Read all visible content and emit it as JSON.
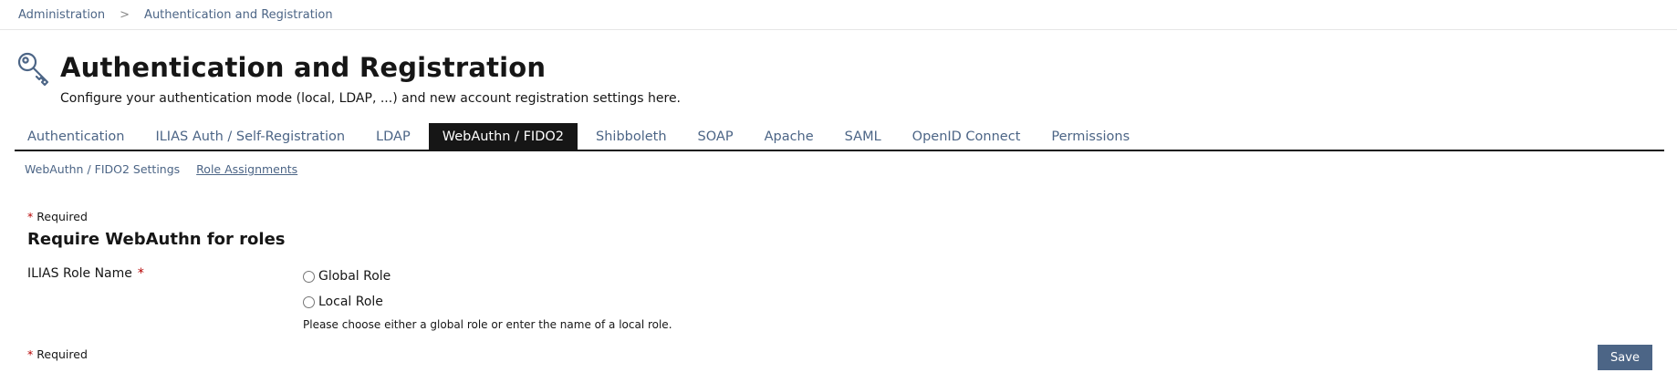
{
  "breadcrumb": {
    "items": [
      "Administration",
      "Authentication and Registration"
    ],
    "separator": ">"
  },
  "header": {
    "icon": "key-icon",
    "title": "Authentication and Registration",
    "description": "Configure your authentication mode (local, LDAP, ...) and new account registration settings here."
  },
  "tabs": [
    {
      "label": "Authentication",
      "active": false
    },
    {
      "label": "ILIAS Auth / Self-Registration",
      "active": false
    },
    {
      "label": "LDAP",
      "active": false
    },
    {
      "label": "WebAuthn / FIDO2",
      "active": true
    },
    {
      "label": "Shibboleth",
      "active": false
    },
    {
      "label": "SOAP",
      "active": false
    },
    {
      "label": "Apache",
      "active": false
    },
    {
      "label": "SAML",
      "active": false
    },
    {
      "label": "OpenID Connect",
      "active": false
    },
    {
      "label": "Permissions",
      "active": false
    }
  ],
  "subtabs": [
    {
      "label": "WebAuthn / FIDO2 Settings",
      "active": false
    },
    {
      "label": "Role Assignments",
      "active": true
    }
  ],
  "form": {
    "required_star": "*",
    "required_label": "Required",
    "section_title": "Require WebAuthn for roles",
    "field_label": "ILIAS Role Name",
    "options": [
      {
        "label": "Global Role",
        "checked": false
      },
      {
        "label": "Local Role",
        "checked": false
      }
    ],
    "byline": "Please choose either a global role or enter the name of a local role.",
    "save_label": "Save"
  },
  "colors": {
    "link": "#4c6586",
    "active_tab_bg": "#161616",
    "required_star": "#b50000",
    "button_bg": "#4c6586"
  }
}
